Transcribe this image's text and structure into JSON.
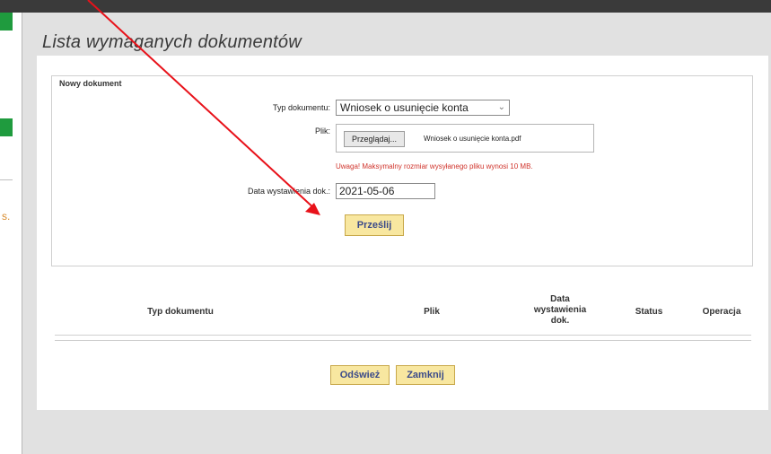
{
  "background": {
    "partial_char": "s."
  },
  "modal": {
    "title": "Lista wymaganych dokumentów",
    "fieldset_legend": "Nowy dokument",
    "form": {
      "doc_type_label": "Typ dokumentu:",
      "doc_type_value": "Wniosek o usunięcie konta",
      "file_label": "Plik:",
      "browse_label": "Przeglądaj...",
      "file_name": "Wniosek o usunięcie konta.pdf",
      "warning": "Uwaga! Maksymalny rozmiar wysyłanego pliku wynosi 10 MB.",
      "date_label": "Data wystawienia dok.:",
      "date_value": "2021-05-06",
      "submit_label": "Prześlij"
    },
    "table": {
      "headers": [
        "Typ dokumentu",
        "Plik",
        "Data wystawienia dok.",
        "Status",
        "Operacja"
      ]
    },
    "footer": {
      "refresh_label": "Odśwież",
      "close_label": "Zamknij"
    }
  },
  "colors": {
    "annotation_arrow": "#e8121a",
    "button_bg": "#f8e7a0",
    "warning_text": "#d0342c",
    "sidebar_green": "#1f9b3e"
  }
}
